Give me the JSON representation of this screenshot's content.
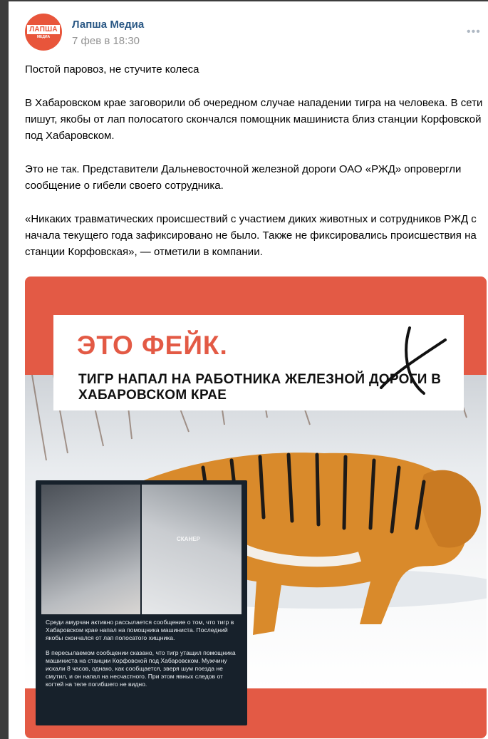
{
  "post": {
    "author": "Лапша Медиа",
    "date": "7 фев в 18:30",
    "more_icon": "ellipsis-icon",
    "avatar": {
      "logo_text": "ЛАПША",
      "logo_sub": "МЕДИА"
    },
    "paragraphs": [
      "Постой паровоз, не стучите колеса",
      "В Хабаровском крае заговорили об очередном случае нападении тигра на человека. В сети пишут, якобы от лап полосатого скончался помощник машиниста близ станции Корфовской под Хабаровском.",
      "Это не так. Представители Дальневосточной железной дороги ОАО «РЖД» опровергли сообщение о гибели своего сотрудника.",
      "«Никаких травматических происшествий с участием диких животных и сотрудников РЖД с начала текущего года зафиксировано не было. Также не фиксировались происшествия на станции Корфовская», — отметили в компании."
    ]
  },
  "image": {
    "fake_title": "ЭТО ФЕЙК.",
    "headline": "ТИГР НАПАЛ НА РАБОТНИКА ЖЕЛЕЗНОЙ ДОРОГИ В ХАБАРОВСКОМ КРАЕ",
    "watermark": "СКАНЕР",
    "telegram_caption_1": "Среди амурчан активно рассылается сообщение о том, что тигр в Хабаровском крае напал на помощника машиниста. Последний якобы скончался от лап полосатого хищника.",
    "telegram_caption_2": "В пересылаемом сообщении сказано, что тигр утащил помощника машиниста на станции Корфовской под Хабаровском. Мужчину искали 8 часов, однако, как сообщается, зверя шум поезда не смутил, и он напал на несчастного. При этом явных следов от когтей на теле погибшего не видно.",
    "colors": {
      "brand_red": "#e35a45",
      "author_blue": "#2a5885"
    }
  }
}
